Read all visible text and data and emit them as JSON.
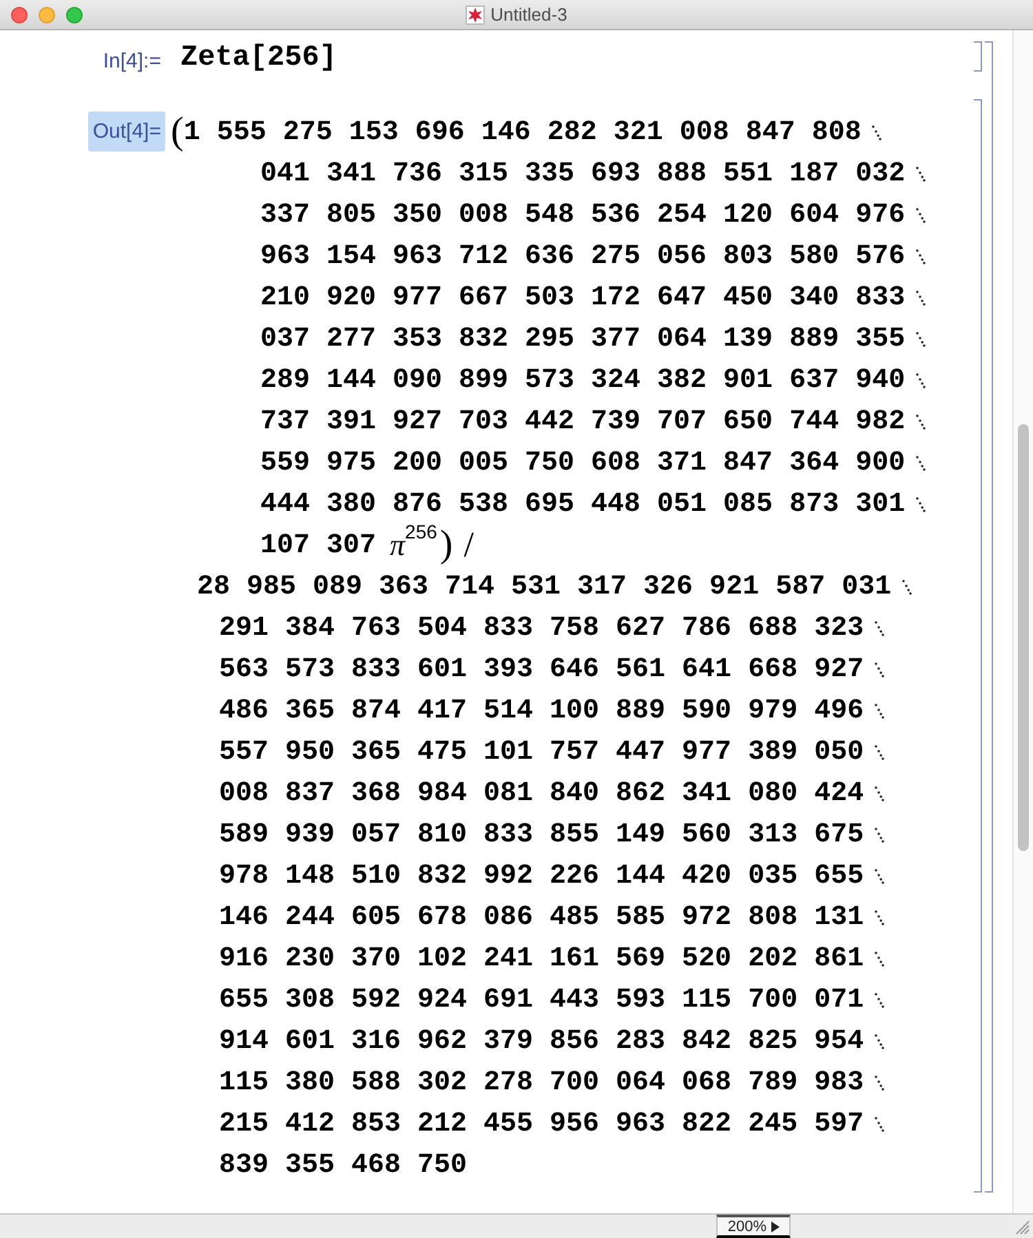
{
  "window": {
    "title": "Untitled-3"
  },
  "input_cell": {
    "label": "In[4]:=",
    "label_selected": false,
    "code": "Zeta[256]"
  },
  "output_cell": {
    "label": "Out[4]=",
    "label_selected": true,
    "open_paren": "(",
    "numerator_lines": [
      {
        "text": "1 555 275 153 696 146 282 321 008 847 808",
        "continued": true
      },
      {
        "text": "041 341 736 315 335 693 888 551 187 032",
        "continued": true
      },
      {
        "text": "337 805 350 008 548 536 254 120 604 976",
        "continued": true
      },
      {
        "text": "963 154 963 712 636 275 056 803 580 576",
        "continued": true
      },
      {
        "text": "210 920 977 667 503 172 647 450 340 833",
        "continued": true
      },
      {
        "text": "037 277 353 832 295 377 064 139 889 355",
        "continued": true
      },
      {
        "text": "289 144 090 899 573 324 382 901 637 940",
        "continued": true
      },
      {
        "text": "737 391 927 703 442 739 707 650 744 982",
        "continued": true
      },
      {
        "text": "559 975 200 005 750 608 371 847 364 900",
        "continued": true
      },
      {
        "text": "444 380 876 538 695 448 051 085 873 301",
        "continued": true
      }
    ],
    "numerator_tail": "107 307",
    "pi": "π",
    "exponent": "256",
    "close_paren": ")",
    "divide": "/",
    "denominator_lines": [
      {
        "text": "28 985 089 363 714 531 317 326 921 587 031",
        "continued": true
      },
      {
        "text": "291 384 763 504 833 758 627 786 688 323",
        "continued": true
      },
      {
        "text": "563 573 833 601 393 646 561 641 668 927",
        "continued": true
      },
      {
        "text": "486 365 874 417 514 100 889 590 979 496",
        "continued": true
      },
      {
        "text": "557 950 365 475 101 757 447 977 389 050",
        "continued": true
      },
      {
        "text": "008 837 368 984 081 840 862 341 080 424",
        "continued": true
      },
      {
        "text": "589 939 057 810 833 855 149 560 313 675",
        "continued": true
      },
      {
        "text": "978 148 510 832 992 226 144 420 035 655",
        "continued": true
      },
      {
        "text": "146 244 605 678 086 485 585 972 808 131",
        "continued": true
      },
      {
        "text": "916 230 370 102 241 161 569 520 202 861",
        "continued": true
      },
      {
        "text": "655 308 592 924 691 443 593 115 700 071",
        "continued": true
      },
      {
        "text": "914 601 316 962 379 856 283 842 825 954",
        "continued": true
      },
      {
        "text": "115 380 588 302 278 700 064 068 789 983",
        "continued": true
      },
      {
        "text": "215 412 853 212 455 956 963 822 245 597",
        "continued": true
      },
      {
        "text": "839 355 468 750",
        "continued": false
      }
    ]
  },
  "status_bar": {
    "zoom": "200%"
  }
}
